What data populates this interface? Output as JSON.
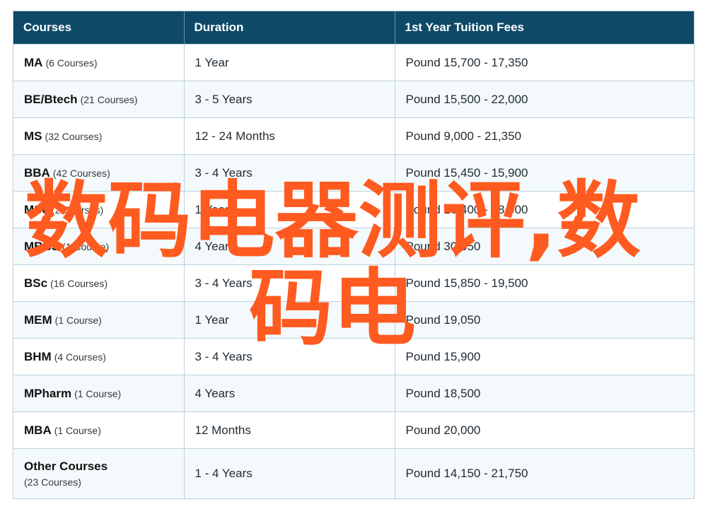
{
  "table": {
    "headers": [
      "Courses",
      "Duration",
      "1st Year Tuition Fees"
    ],
    "rows": [
      {
        "course": "MA",
        "count": "(6 Courses)",
        "duration": "1 Year",
        "fees": "Pound 15,700 - 17,350"
      },
      {
        "course": "BE/Btech",
        "count": "(21 Courses)",
        "duration": "3 - 5 Years",
        "fees": "Pound 15,500 - 22,000"
      },
      {
        "course": "MS",
        "count": "(32 Courses)",
        "duration": "12 - 24 Months",
        "fees": "Pound 9,000 - 21,350"
      },
      {
        "course": "BBA",
        "count": "(42 Courses)",
        "duration": "3 - 4 Years",
        "fees": "Pound 15,450 - 15,900"
      },
      {
        "course": "MSc",
        "count": "(2 Courses)",
        "duration": "1 Year",
        "fees": "Pound 16,400 - 18,900"
      },
      {
        "course": "MBBS",
        "count": "(1 Course)",
        "duration": "4 Years",
        "fees": "Pound 30,050"
      },
      {
        "course": "BSc",
        "count": "(16 Courses)",
        "duration": "3 - 4 Years",
        "fees": "Pound 15,850 - 19,500"
      },
      {
        "course": "MEM",
        "count": "(1 Course)",
        "duration": "1 Year",
        "fees": "Pound 19,050"
      },
      {
        "course": "BHM",
        "count": "(4 Courses)",
        "duration": "3 - 4 Years",
        "fees": "Pound 15,900"
      },
      {
        "course": "MPharm",
        "count": "(1 Course)",
        "duration": "4 Years",
        "fees": "Pound 18,500"
      },
      {
        "course": "MBA",
        "count": "(1 Course)",
        "duration": "12 Months",
        "fees": "Pound 20,000"
      },
      {
        "course": "Other Courses",
        "count": "(23 Courses)",
        "duration": "1 - 4 Years",
        "fees": "Pound 14,150 - 21,750"
      }
    ]
  },
  "watermark": {
    "line1": "数码电器测评,数",
    "line2": "码电",
    "color": "#ff5a1f"
  },
  "colors": {
    "header_bg": "#0e4a68",
    "header_text": "#ffffff",
    "border": "#bcd2de",
    "row_alt": "#f4f9fb"
  }
}
